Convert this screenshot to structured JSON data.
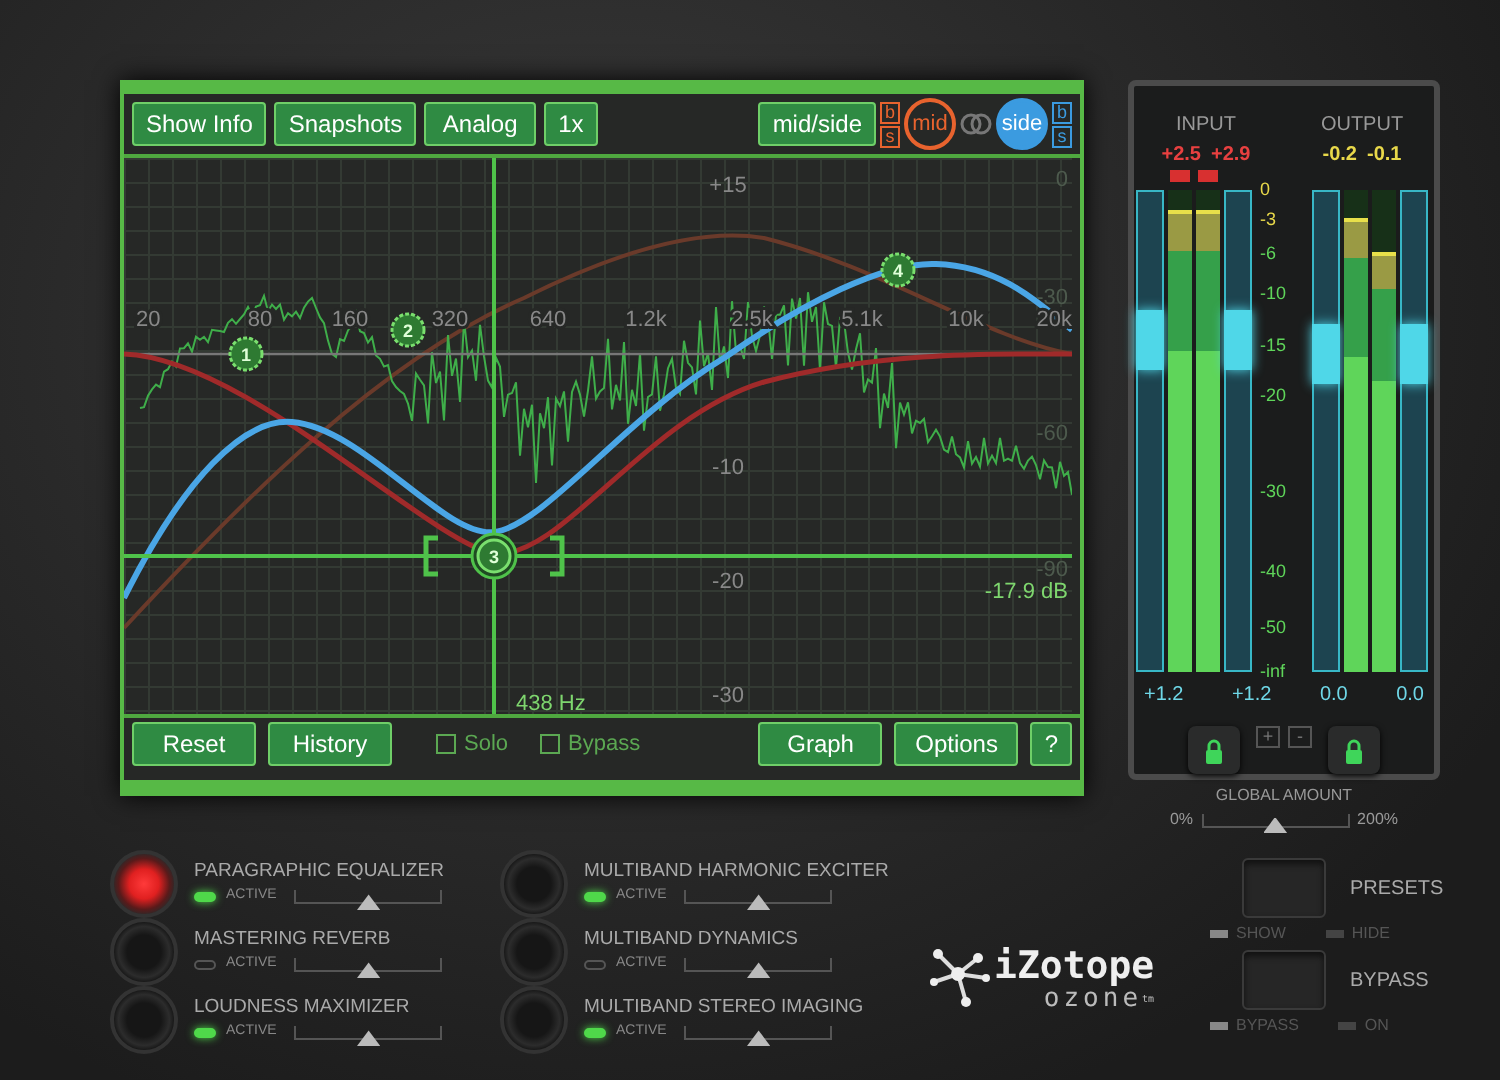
{
  "toolbar": {
    "buttons": [
      "Show Info",
      "Snapshots",
      "Analog",
      "1x"
    ]
  },
  "stereo": {
    "button": "mid/side",
    "channels": [
      {
        "label": "mid",
        "b": "b",
        "s": "s",
        "selected": false,
        "color": "#e8632e"
      },
      {
        "label": "side",
        "b": "b",
        "s": "s",
        "selected": true,
        "color": "#3b9be0"
      }
    ]
  },
  "graph": {
    "freq_labels": [
      "20",
      "80",
      "160",
      "320",
      "640",
      "1.2k",
      "2.5k",
      "5.1k",
      "10k",
      "20k"
    ],
    "gain_labels": [
      "+15",
      "-10",
      "-20",
      "-30"
    ],
    "spectrum_labels": [
      "0",
      "-30",
      "-60",
      "-90"
    ],
    "nodes": [
      {
        "label": "1",
        "selected": false
      },
      {
        "label": "2",
        "selected": false
      },
      {
        "label": "3",
        "selected": true
      },
      {
        "label": "4",
        "selected": false
      }
    ],
    "gain_reading": "-17.9 dB",
    "freq_reading": "438 Hz"
  },
  "bottom_bar": {
    "left_buttons": [
      "Reset",
      "History"
    ],
    "checks": [
      {
        "label": "Solo",
        "checked": false
      },
      {
        "label": "Bypass",
        "checked": false
      }
    ],
    "right_buttons": [
      "Graph",
      "Options",
      "?"
    ]
  },
  "meters": {
    "groups": [
      {
        "title": "INPUT",
        "clip": true,
        "sliders": [
          {
            "level": 0.69
          },
          {
            "level": 0.69
          }
        ],
        "channels": [
          {
            "peak": "+2.5",
            "level": 0.96,
            "reading": "+1.2"
          },
          {
            "peak": "+2.9",
            "level": 0.96,
            "reading": "+1.2"
          }
        ]
      },
      {
        "title": "OUTPUT",
        "clip": false,
        "sliders": [
          {
            "level": 0.66
          },
          {
            "level": 0.66
          }
        ],
        "channels": [
          {
            "peak": "-0.2",
            "level": 0.94,
            "reading": "0.0"
          },
          {
            "peak": "-0.1",
            "level": 0.87,
            "reading": "0.0"
          }
        ]
      }
    ],
    "scale": [
      "0",
      "-3",
      "-6",
      "-10",
      "-15",
      "-20",
      "-30",
      "-40",
      "-50",
      "-inf"
    ],
    "locks": [
      {
        "on": true
      },
      {
        "on": true
      }
    ],
    "link_buttons": [
      "+",
      "-"
    ]
  },
  "global_amount": {
    "title": "GLOBAL AMOUNT",
    "min": "0%",
    "max": "200%",
    "level": 0.5
  },
  "modules": [
    {
      "name": "PARAGRAPHIC EQUALIZER",
      "selected": true,
      "active": true,
      "active_label": "ACTIVE",
      "level": 0.5
    },
    {
      "name": "MASTERING REVERB",
      "selected": false,
      "active": false,
      "active_label": "ACTIVE",
      "level": 0.5
    },
    {
      "name": "LOUDNESS MAXIMIZER",
      "selected": false,
      "active": true,
      "active_label": "ACTIVE",
      "level": 0.5
    },
    {
      "name": "MULTIBAND HARMONIC EXCITER",
      "selected": false,
      "active": true,
      "active_label": "ACTIVE",
      "level": 0.5
    },
    {
      "name": "MULTIBAND DYNAMICS",
      "selected": false,
      "active": false,
      "active_label": "ACTIVE",
      "level": 0.5
    },
    {
      "name": "MULTIBAND STEREO IMAGING",
      "selected": false,
      "active": true,
      "active_label": "ACTIVE",
      "level": 0.5
    }
  ],
  "logo": {
    "brand": "iZotope",
    "product": "ozone",
    "mark": "tm"
  },
  "toggles": [
    {
      "title": "PRESETS",
      "off_label": "SHOW",
      "on_label": "HIDE",
      "on": false
    },
    {
      "title": "BYPASS",
      "off_label": "BYPASS",
      "on_label": "ON",
      "on": false
    }
  ]
}
